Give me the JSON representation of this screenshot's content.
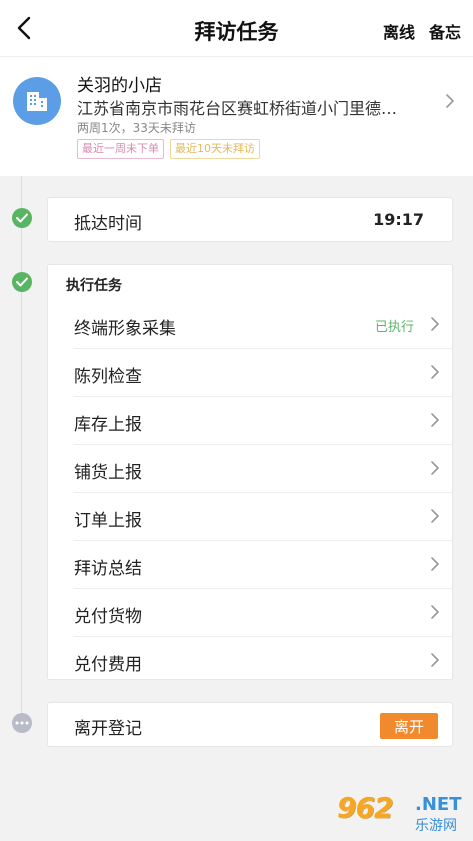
{
  "header": {
    "title": "拜访任务",
    "action_offline": "离线",
    "action_memo": "备忘"
  },
  "store": {
    "name": "关羽的小店",
    "address": "江苏省南京市雨花台区赛虹桥街道小门里德…",
    "frequency": "两周1次，33天未拜访",
    "tags": [
      "最近一周未下单",
      "最近10天未拜访"
    ]
  },
  "arrival": {
    "label": "抵达时间",
    "time": "19:17"
  },
  "tasks": {
    "heading": "执行任务",
    "items": [
      {
        "label": "终端形象采集",
        "status": "已执行"
      },
      {
        "label": "陈列检查",
        "status": ""
      },
      {
        "label": "库存上报",
        "status": ""
      },
      {
        "label": "铺货上报",
        "status": ""
      },
      {
        "label": "订单上报",
        "status": ""
      },
      {
        "label": "拜访总结",
        "status": ""
      },
      {
        "label": "兑付货物",
        "status": ""
      },
      {
        "label": "兑付费用",
        "status": ""
      }
    ]
  },
  "leave": {
    "label": "离开登记",
    "button": "离开"
  },
  "watermark": {
    "logo": "962",
    "net": ".NET",
    "cn": "乐游网"
  },
  "colors": {
    "accent_green": "#58b562",
    "accent_orange": "#f08a2c",
    "avatar_blue": "#5b9ee6"
  }
}
